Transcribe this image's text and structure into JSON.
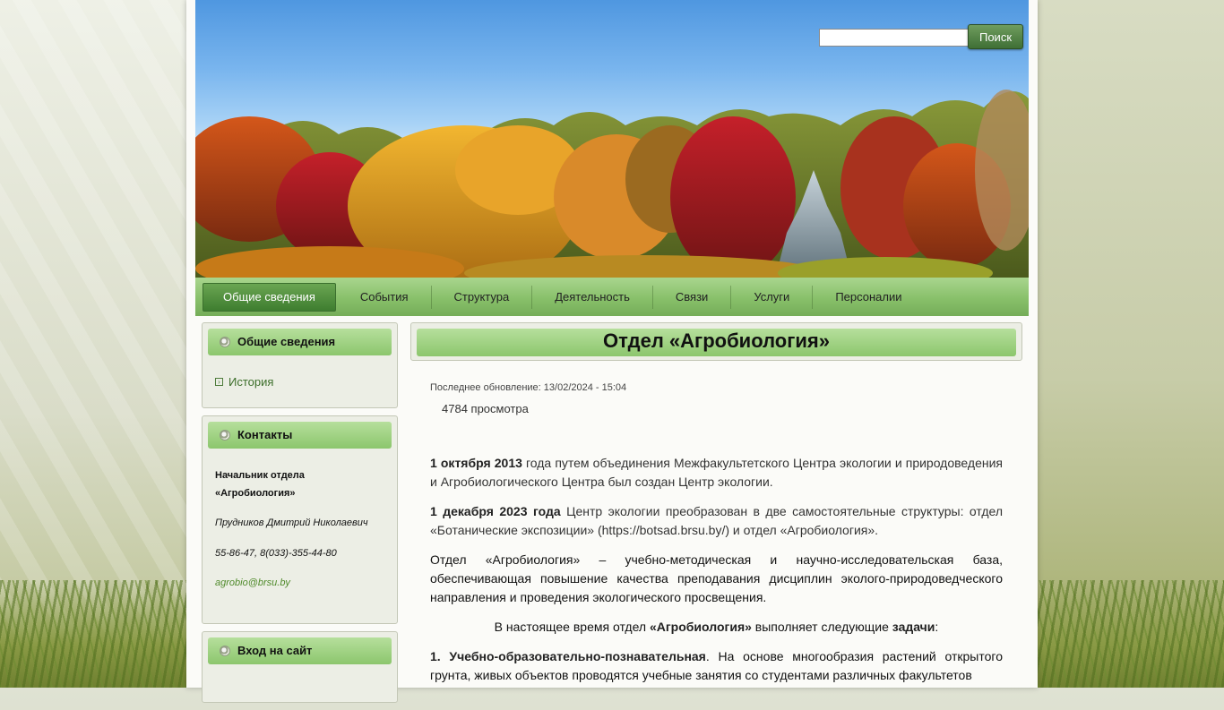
{
  "search": {
    "placeholder": "",
    "button_label": "Поиск"
  },
  "nav": {
    "items": [
      "Общие сведения",
      "События",
      "Структура",
      "Деятельность",
      "Связи",
      "Услуги",
      "Персоналии"
    ],
    "active_index": 0
  },
  "sidebar": {
    "general": {
      "title": "Общие сведения",
      "links": [
        "История"
      ]
    },
    "contacts": {
      "title": "Контакты",
      "head_line1": "Начальник отдела",
      "head_line2": "«Агробиология»",
      "name": "Прудников Дмитрий Николаевич",
      "phones": "55-86-47, 8(033)-355-44-80",
      "email": "agrobio@brsu.by"
    },
    "login": {
      "title": "Вход на сайт"
    }
  },
  "article": {
    "title": "Отдел «Агробиология»",
    "updated": "Последнее обновление: 13/02/2024 - 15:04",
    "views": "4784 просмотра",
    "p1_bold": "1 октября 2013",
    "p1_text": " года путем объединения Межфакультетского Центра экологии и природоведения и Агробиологического Центра был создан Центр экологии.",
    "p2_bold": "1 декабря 2023 года",
    "p2_text": "  Центр экологии преобразован в две самостоятельные структуры: отдел «Ботанические экспозиции» (https://botsad.brsu.by/) и отдел «Агробиология».",
    "p3_text": "Отдел «Агробиология» – учебно-методическая и научно-исследовательская база, обеспечивающая повышение качества преподавания дисциплин эколого-природоведческого направления и проведения экологического просвещения.",
    "p4_pre": "В настоящее время  отдел ",
    "p4_bold": "«Агробиология»",
    "p4_mid": " выполняет следующие ",
    "p4_bold2": "задачи",
    "p4_end": ":",
    "p5_bold": "1. Учебно-образовательно-познавательная",
    "p5_text": ". На основе многообразия  растений открытого грунта, живых объектов проводятся учебные занятия со студентами различных факультетов"
  },
  "colors": {
    "accent_green": "#8cc66d",
    "nav_active": "#3e7d2f",
    "link_green": "#3c6e2a"
  }
}
